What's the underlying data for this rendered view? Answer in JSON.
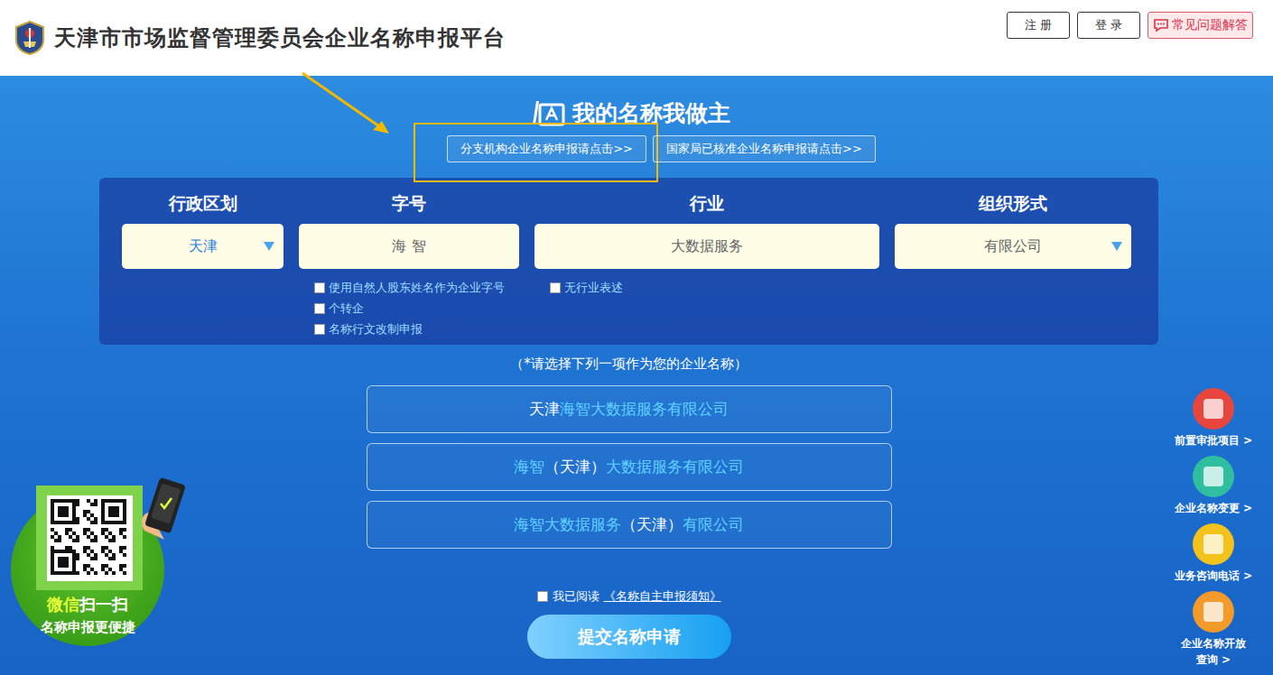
{
  "header": {
    "title": "天津市市场监督管理委员会企业名称申报平台",
    "buttons": [
      {
        "label": "注 册",
        "kind": "plain"
      },
      {
        "label": "登 录",
        "kind": "plain"
      },
      {
        "label": "常见问题解答",
        "kind": "help"
      }
    ]
  },
  "hero": {
    "title": "我的名称我做主",
    "links": [
      {
        "label": "分支机构企业名称申报请点击>>",
        "highlighted": true
      },
      {
        "label": "国家局已核准企业名称申报请点击>>",
        "highlighted": false
      }
    ]
  },
  "form": {
    "fields": [
      {
        "label": "行政区划",
        "value": "天津",
        "kind": "select",
        "placeholder": false,
        "checks": []
      },
      {
        "label": "字号",
        "value": "海 智",
        "kind": "input",
        "placeholder": true,
        "checks": [
          {
            "label": "使用自然人股东姓名作为企业字号",
            "checked": false
          },
          {
            "label": "个转企",
            "checked": false
          },
          {
            "label": "名称行文改制申报",
            "checked": false
          }
        ]
      },
      {
        "label": "行业",
        "value": "大数据服务",
        "kind": "input",
        "placeholder": true,
        "checks": [
          {
            "label": "无行业表述",
            "checked": false
          }
        ]
      },
      {
        "label": "组织形式",
        "value": "有限公司",
        "kind": "select",
        "placeholder": true,
        "checks": []
      }
    ]
  },
  "prompt": "（*请选择下列一项作为您的企业名称）",
  "options": [
    {
      "selected": false,
      "segments": [
        {
          "text": "天津",
          "kind": "region"
        },
        {
          "text": "海智大数据服务有限公司",
          "kind": "name"
        }
      ]
    },
    {
      "selected": false,
      "segments": [
        {
          "text": "海智",
          "kind": "name"
        },
        {
          "text": "（天津）",
          "kind": "region"
        },
        {
          "text": "大数据服务有限公司",
          "kind": "name"
        }
      ]
    },
    {
      "selected": false,
      "segments": [
        {
          "text": "海智大数据服务",
          "kind": "name"
        },
        {
          "text": "（天津）",
          "kind": "region"
        },
        {
          "text": "有限公司",
          "kind": "name"
        }
      ]
    }
  ],
  "agreement": {
    "label": "我已阅读",
    "link": "《名称自主申报须知》",
    "checked": false
  },
  "submit": "提交名称申请",
  "qr": {
    "line1": [
      {
        "text": "微信",
        "kind": "accent"
      },
      {
        "text": "扫一扫",
        "kind": "plain"
      }
    ],
    "line2": "名称申报更便捷"
  },
  "side": [
    {
      "lines": [
        "前置审批项目 >"
      ],
      "color": "#e8453c"
    },
    {
      "lines": [
        "企业名称变更 >"
      ],
      "color": "#2fbf9f"
    },
    {
      "lines": [
        "业务咨询电话 >"
      ],
      "color": "#f3c21b"
    },
    {
      "lines": [
        "企业名称开放",
        "查询 >"
      ],
      "color": "#f39a2a"
    }
  ]
}
